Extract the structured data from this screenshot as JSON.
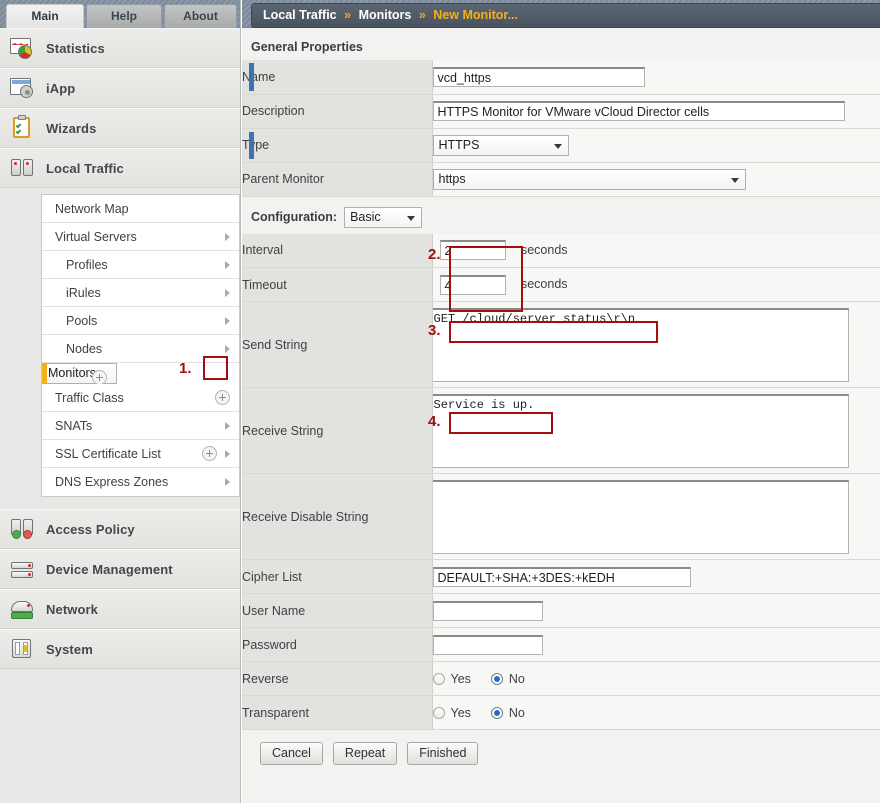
{
  "tabs": [
    {
      "label": "Main",
      "active": true
    },
    {
      "label": "Help",
      "active": false
    },
    {
      "label": "About",
      "active": false
    }
  ],
  "nav": {
    "sections": [
      {
        "label": "Statistics",
        "icon": "statistics-icon"
      },
      {
        "label": "iApp",
        "icon": "iapp-icon"
      },
      {
        "label": "Wizards",
        "icon": "wizards-icon"
      },
      {
        "label": "Local Traffic",
        "icon": "local-traffic-icon"
      },
      {
        "label": "Access Policy",
        "icon": "access-policy-icon"
      },
      {
        "label": "Device Management",
        "icon": "device-management-icon"
      },
      {
        "label": "Network",
        "icon": "network-icon"
      },
      {
        "label": "System",
        "icon": "system-icon"
      }
    ],
    "submenu": [
      {
        "label": "Network Map",
        "indent": false,
        "arrow": false,
        "plus": false,
        "selected": false
      },
      {
        "label": "Virtual Servers",
        "indent": false,
        "arrow": true,
        "plus": false,
        "selected": false
      },
      {
        "label": "Profiles",
        "indent": true,
        "arrow": true,
        "plus": false,
        "selected": false
      },
      {
        "label": "iRules",
        "indent": true,
        "arrow": true,
        "plus": false,
        "selected": false
      },
      {
        "label": "Pools",
        "indent": true,
        "arrow": true,
        "plus": false,
        "selected": false
      },
      {
        "label": "Nodes",
        "indent": true,
        "arrow": true,
        "plus": false,
        "selected": false
      },
      {
        "label": "Monitors",
        "indent": false,
        "arrow": false,
        "plus": true,
        "selected": true
      },
      {
        "label": "Traffic Class",
        "indent": false,
        "arrow": false,
        "plus": true,
        "selected": false
      },
      {
        "label": "SNATs",
        "indent": false,
        "arrow": true,
        "plus": false,
        "selected": false
      },
      {
        "label": "SSL Certificate List",
        "indent": false,
        "arrow": true,
        "plus": true,
        "selected": false
      },
      {
        "label": "DNS Express Zones",
        "indent": false,
        "arrow": true,
        "plus": false,
        "selected": false
      }
    ]
  },
  "breadcrumb": {
    "root": "Local Traffic",
    "separator": "»",
    "mid": "Monitors",
    "current": "New Monitor..."
  },
  "general_properties": {
    "title": "General Properties",
    "name": {
      "label": "Name",
      "value": "vcd_https",
      "required": true
    },
    "description": {
      "label": "Description",
      "value": "HTTPS Monitor for VMware vCloud Director cells",
      "required": false
    },
    "type": {
      "label": "Type",
      "value": "HTTPS",
      "required": true
    },
    "parent_monitor": {
      "label": "Parent Monitor",
      "value": "https",
      "required": false
    }
  },
  "configuration": {
    "label": "Configuration:",
    "mode": "Basic",
    "interval": {
      "label": "Interval",
      "value": "2",
      "unit": "seconds"
    },
    "timeout": {
      "label": "Timeout",
      "value": "4",
      "unit": "seconds"
    },
    "send_string": {
      "label": "Send String",
      "value": "GET /cloud/server_status\\r\\n"
    },
    "receive_string": {
      "label": "Receive String",
      "value": "Service is up."
    },
    "receive_disable_string": {
      "label": "Receive Disable String",
      "value": ""
    },
    "cipher_list": {
      "label": "Cipher List",
      "value": "DEFAULT:+SHA:+3DES:+kEDH"
    },
    "user_name": {
      "label": "User Name",
      "value": ""
    },
    "password": {
      "label": "Password",
      "value": ""
    },
    "reverse": {
      "label": "Reverse",
      "yes": "Yes",
      "no": "No",
      "selected": "No"
    },
    "transparent": {
      "label": "Transparent",
      "yes": "Yes",
      "no": "No",
      "selected": "No"
    }
  },
  "buttons": {
    "cancel": "Cancel",
    "repeat": "Repeat",
    "finished": "Finished"
  },
  "annotations": [
    {
      "num": "1."
    },
    {
      "num": "2."
    },
    {
      "num": "3."
    },
    {
      "num": "4."
    }
  ],
  "colors": {
    "annotation_red": "#a30f0f",
    "required_marker_blue": "#3f72b2",
    "selected_nav_amber": "#f5b01a",
    "breadcrumb_current": "#f5b01a",
    "radio_selected": "#1f6fc4"
  }
}
